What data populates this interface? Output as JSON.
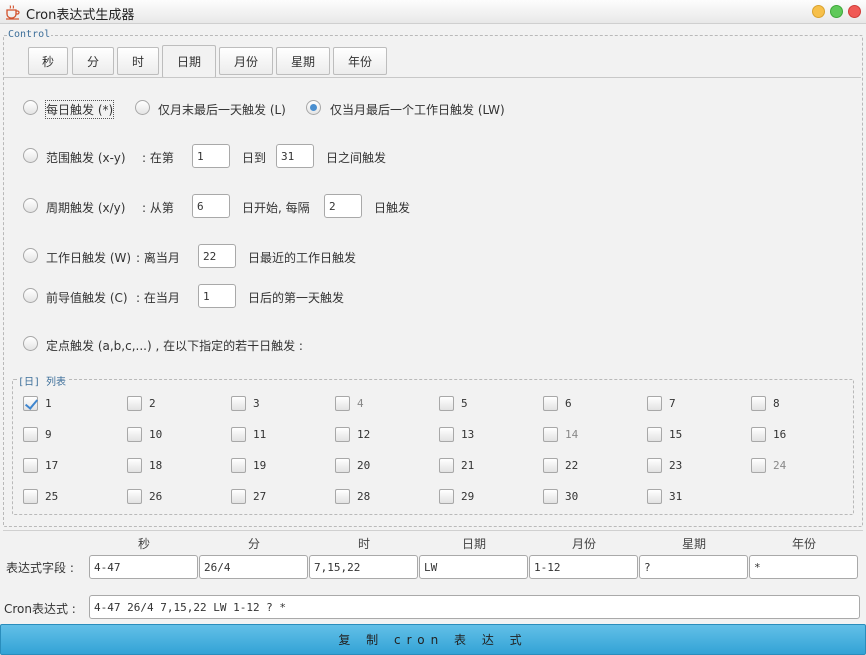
{
  "window": {
    "title": "Cron表达式生成器"
  },
  "control": {
    "legend": "Control",
    "tabs": [
      "秒",
      "分",
      "时",
      "日期",
      "月份",
      "星期",
      "年份"
    ],
    "options": {
      "every_day": "每日触发 (*)",
      "last_day_of_month": "仅月末最后一天触发 (L)",
      "last_workday_of_month": "仅当月最后一个工作日触发 (LW)",
      "range": {
        "label": "范围触发 (x-y)",
        "from_prefix": ": 在第",
        "from_value": "1",
        "to_prefix": "日到",
        "to_value": "31",
        "suffix": "日之间触发"
      },
      "cycle": {
        "label": "周期触发 (x/y)",
        "start_prefix": ": 从第",
        "start_value": "6",
        "mid": "日开始, 每隔",
        "step_value": "2",
        "suffix": "日触发"
      },
      "workday": {
        "label": "工作日触发 (W)",
        "prefix": ": 离当月",
        "value": "22",
        "suffix": "日最近的工作日触发"
      },
      "leading": {
        "label": "前导值触发 (C)",
        "prefix": ": 在当月",
        "value": "1",
        "suffix": "日后的第一天触发"
      },
      "fixed": {
        "label": "定点触发 (a,b,c,...) , 在以下指定的若干日触发 :"
      }
    },
    "day_list": {
      "legend": "[日] 列表",
      "days": [
        "1",
        "2",
        "3",
        "4",
        "5",
        "6",
        "7",
        "8",
        "9",
        "10",
        "11",
        "12",
        "13",
        "14",
        "15",
        "16",
        "17",
        "18",
        "19",
        "20",
        "21",
        "22",
        "23",
        "24",
        "25",
        "26",
        "27",
        "28",
        "29",
        "30",
        "31"
      ]
    }
  },
  "fields": {
    "column_headers": [
      "秒",
      "分",
      "时",
      "日期",
      "月份",
      "星期",
      "年份"
    ],
    "row_label": "表达式字段 :",
    "values": [
      "4-47",
      "26/4",
      "7,15,22",
      "LW",
      "1-12",
      "?",
      "*"
    ]
  },
  "expression": {
    "label": "Cron表达式 :",
    "value": "4-47 26/4 7,15,22 LW 1-12 ? *"
  },
  "copy_button": "复 制 cron 表 达 式",
  "colors": {
    "accent": "#3f86cf",
    "button": "#33a3d6",
    "legend": "#3d6f9a"
  }
}
